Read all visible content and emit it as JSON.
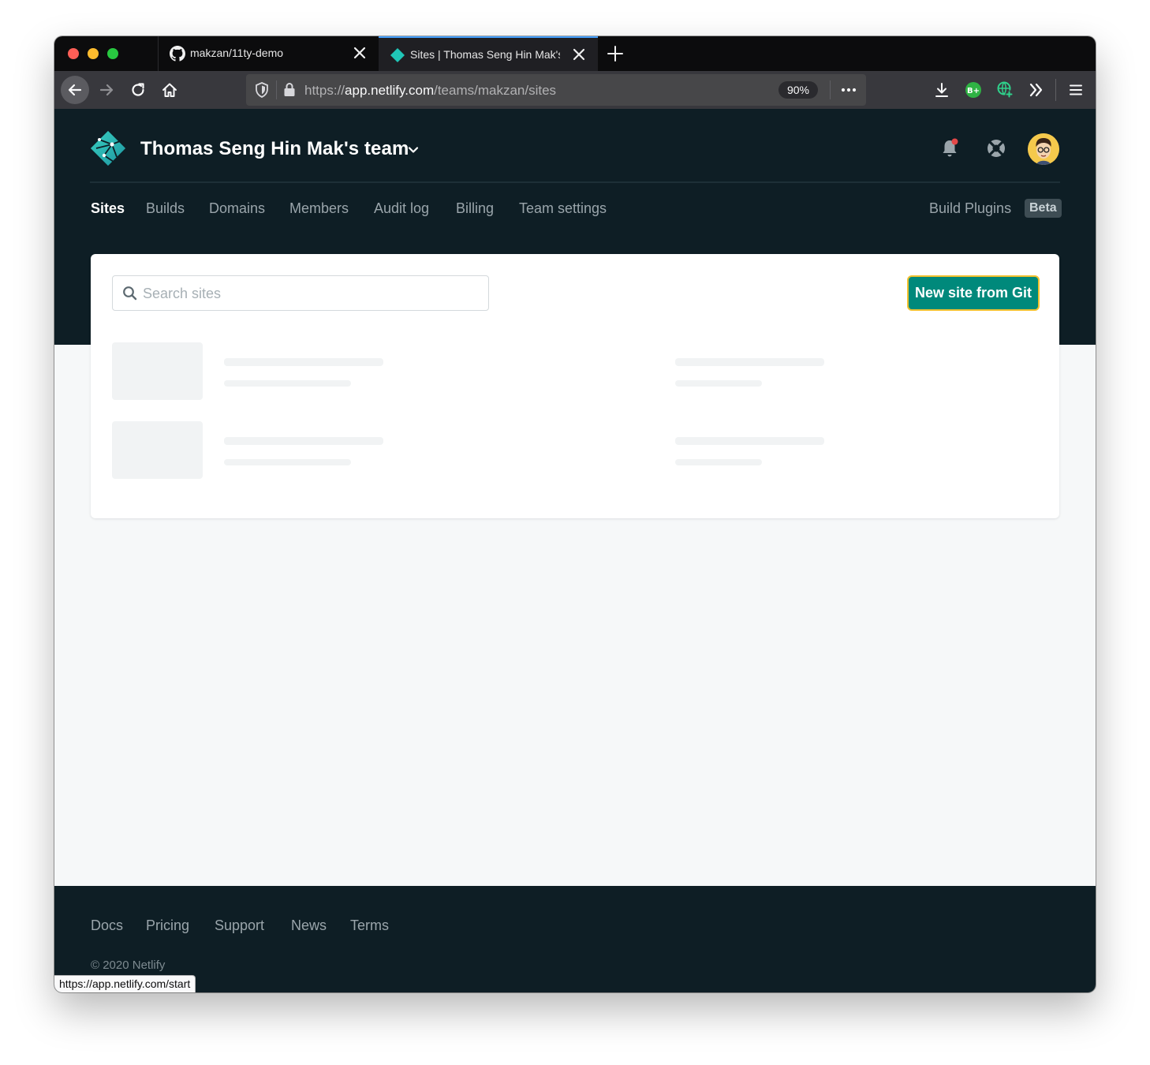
{
  "browser": {
    "tabs": [
      {
        "title": "makzan/11ty-demo",
        "icon": "github-icon",
        "active": false
      },
      {
        "title": "Sites | Thomas Seng Hin Mak's",
        "icon": "netlify-favicon-icon",
        "active": true
      }
    ],
    "url": {
      "scheme": "https://",
      "host": "app.netlify.com",
      "path": "/teams/makzan/sites"
    },
    "zoom": "90%",
    "status_url": "https://app.netlify.com/start"
  },
  "header": {
    "team_name": "Thomas Seng Hin Mak's team",
    "nav": [
      "Sites",
      "Builds",
      "Domains",
      "Members",
      "Audit log",
      "Billing",
      "Team settings"
    ],
    "active_nav": "Sites",
    "build_plugins": "Build Plugins",
    "beta": "Beta"
  },
  "sites": {
    "search_placeholder": "Search sites",
    "new_site_label": "New site from Git"
  },
  "footer": {
    "links": [
      "Docs",
      "Pricing",
      "Support",
      "News",
      "Terms"
    ],
    "copyright": "© 2020 Netlify"
  },
  "colors": {
    "brand_teal": "#00897b",
    "header_bg": "#0e1e25",
    "focus_ring": "#f2c12e"
  }
}
